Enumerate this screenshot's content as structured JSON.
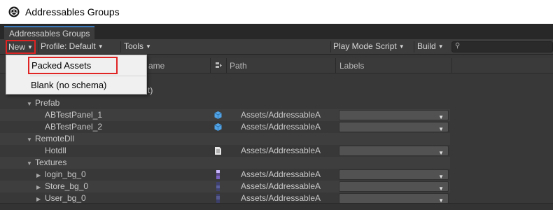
{
  "window": {
    "title": "Addressables Groups"
  },
  "tab": {
    "label": "Addressables Groups"
  },
  "toolbar": {
    "new_label": "New",
    "profile_label": "Profile: Default",
    "tools_label": "Tools",
    "play_mode_label": "Play Mode Script",
    "build_label": "Build",
    "search_icon": "search-icon",
    "search_value": ""
  },
  "columns": {
    "name_partial": "ame",
    "path": "Path",
    "labels": "Labels"
  },
  "menu": {
    "items": [
      {
        "label": "Packed Assets"
      },
      {
        "label": "Blank (no schema)"
      }
    ]
  },
  "tree": {
    "hidden_row_partial": "t)",
    "rows": [
      {
        "label": "Prefab",
        "level": 1,
        "expanded": true,
        "is_group": true
      },
      {
        "label": "ABTestPanel_1",
        "level": 2,
        "icon": "prefab-cube-icon",
        "path": "Assets/AddressableA"
      },
      {
        "label": "ABTestPanel_2",
        "level": 2,
        "icon": "prefab-cube-icon",
        "path": "Assets/AddressableA"
      },
      {
        "label": "RemoteDll",
        "level": 1,
        "expanded": true,
        "is_group": true
      },
      {
        "label": "Hotdll",
        "level": 2,
        "icon": "text-asset-icon",
        "path": "Assets/AddressableA"
      },
      {
        "label": "Textures",
        "level": 1,
        "expanded": true,
        "is_group": true
      },
      {
        "label": "login_bg_0",
        "level": 2,
        "icon": "texture-icon",
        "path": "Assets/AddressableA",
        "collapsed_child": true
      },
      {
        "label": "Store_bg_0",
        "level": 2,
        "icon": "texture-icon",
        "path": "Assets/AddressableA",
        "collapsed_child": true
      },
      {
        "label": "User_bg_0",
        "level": 2,
        "icon": "texture-icon",
        "path": "Assets/AddressableA",
        "collapsed_child": true
      }
    ]
  },
  "colors": {
    "accent_highlight_box": "#e02424",
    "panel_bg": "#383838",
    "prefab_icon": "#4fa3e6"
  }
}
